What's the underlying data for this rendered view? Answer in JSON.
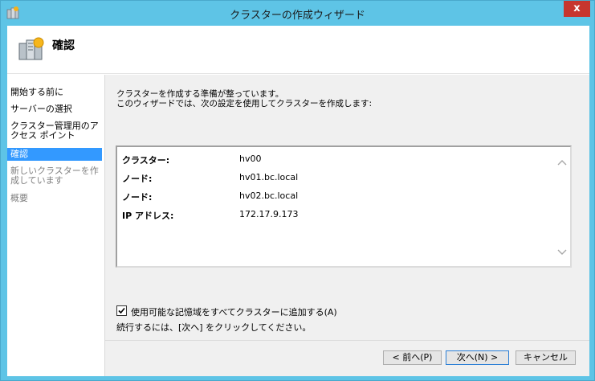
{
  "window": {
    "title": "クラスターの作成ウィザード",
    "close_label": "x"
  },
  "header": {
    "title": "確認"
  },
  "nav": {
    "items": [
      {
        "label": "開始する前に",
        "state": "normal"
      },
      {
        "label": "サーバーの選択",
        "state": "normal"
      },
      {
        "label": "クラスター管理用のアクセス ポイント",
        "state": "normal"
      },
      {
        "label": "確認",
        "state": "selected"
      },
      {
        "label": "新しいクラスターを作成しています",
        "state": "disabled"
      },
      {
        "label": "概要",
        "state": "disabled"
      }
    ]
  },
  "content": {
    "intro_line1": "クラスターを作成する準備が整っています。",
    "intro_line2": "このウィザードでは、次の設定を使用してクラスターを作成します:",
    "summary": [
      {
        "key": "クラスター:",
        "value": "hv00"
      },
      {
        "key": "ノード:",
        "value": "hv01.bc.local"
      },
      {
        "key": "ノード:",
        "value": "hv02.bc.local"
      },
      {
        "key": "IP アドレス:",
        "value": "172.17.9.173"
      }
    ],
    "checkbox_label": "使用可能な記憶域をすべてクラスターに追加する(A)",
    "checkbox_checked": true,
    "continue_text": "続行するには、[次へ] をクリックしてください。"
  },
  "buttons": {
    "back": "< 前へ(P)",
    "next": "次へ(N) >",
    "cancel": "キャンセル"
  }
}
